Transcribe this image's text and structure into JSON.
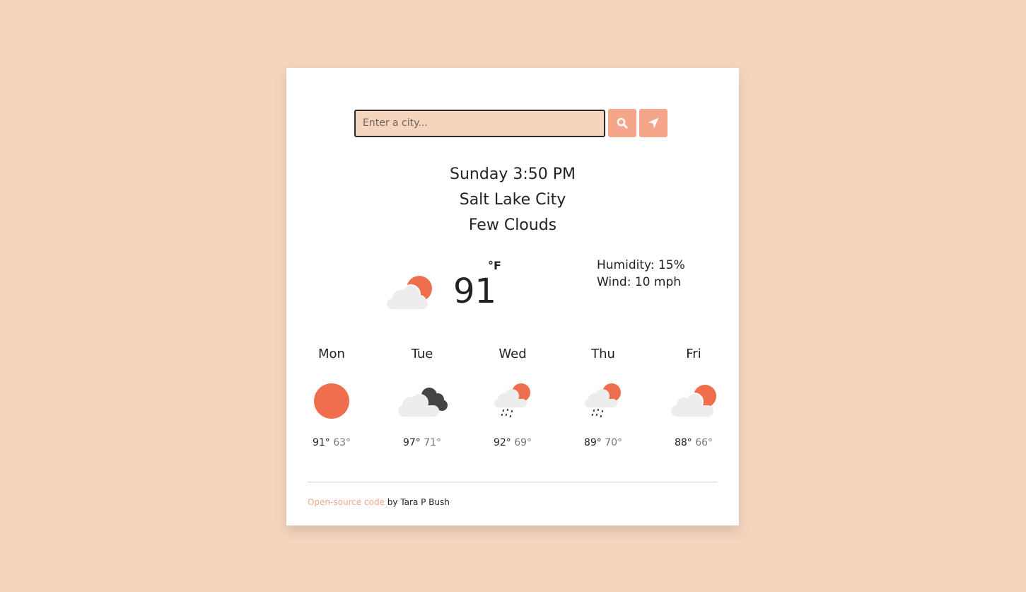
{
  "search": {
    "placeholder": "Enter a city...",
    "value": ""
  },
  "icons": {
    "search_button": "search-icon",
    "location_button": "location-arrow-icon"
  },
  "current": {
    "datetime": "Sunday 3:50 PM",
    "city": "Salt Lake City",
    "description": "Few Clouds",
    "icon": "partly-cloudy-icon",
    "temperature": "91",
    "unit": "°F",
    "humidity": "Humidity: 15%",
    "wind": "Wind: 10 mph"
  },
  "forecast": [
    {
      "day": "Mon",
      "icon": "sun-icon",
      "high": "91°",
      "low": "63°"
    },
    {
      "day": "Tue",
      "icon": "dark-cloud-icon",
      "high": "97°",
      "low": "71°"
    },
    {
      "day": "Wed",
      "icon": "rain-sun-icon",
      "high": "92°",
      "low": "69°"
    },
    {
      "day": "Thu",
      "icon": "rain-sun-icon",
      "high": "89°",
      "low": "70°"
    },
    {
      "day": "Fri",
      "icon": "partly-cloudy-icon",
      "high": "88°",
      "low": "66°"
    }
  ],
  "footer": {
    "link_text": "Open-source code",
    "suffix": " by Tara P Bush"
  },
  "colors": {
    "background": "#f6d5be",
    "accent": "#f5a58a",
    "sun": "#ee6e4d",
    "cloud": "#ededed",
    "dark_cloud": "#444444"
  }
}
